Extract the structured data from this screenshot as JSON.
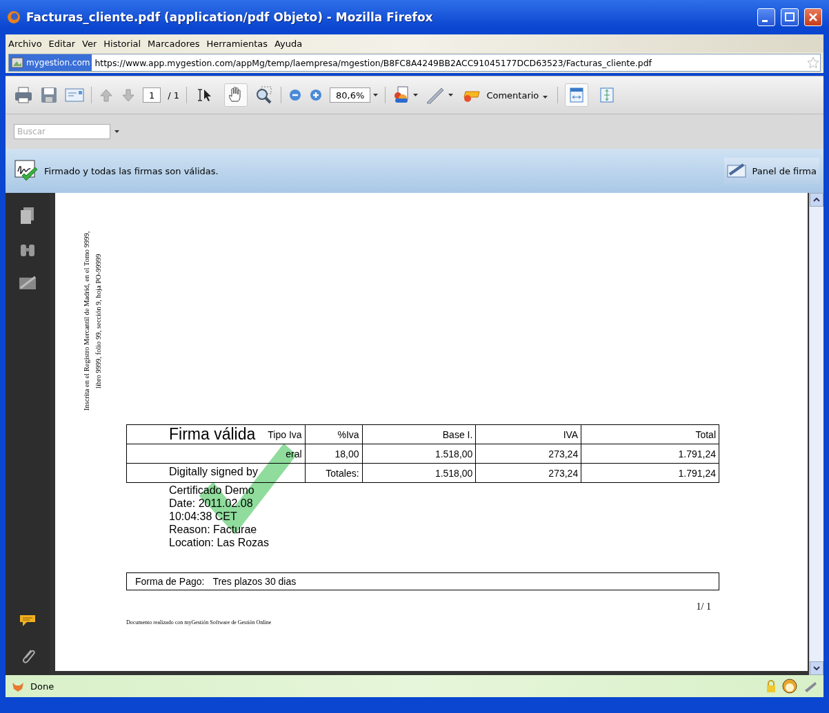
{
  "window": {
    "title": "Facturas_cliente.pdf (application/pdf Objeto) - Mozilla Firefox"
  },
  "menu": [
    {
      "label": "Archivo"
    },
    {
      "label": "Editar"
    },
    {
      "label": "Ver"
    },
    {
      "label": "Historial"
    },
    {
      "label": "Marcadores"
    },
    {
      "label": "Herramientas"
    },
    {
      "label": "Ayuda"
    }
  ],
  "address_bar": {
    "site": "mygestion.com",
    "url": "https://www.app.mygestion.com/appMg/temp/laempresa/mgestion/B8FC8A4249BB2ACC91045177DCD63523/Facturas_cliente.pdf"
  },
  "toolbar": {
    "page_field": "1",
    "page_total": "/ 1",
    "tools": [
      {
        "kind": "select",
        "selected": false
      },
      {
        "kind": "hand",
        "selected": true
      }
    ],
    "zoom_field": "80,6%",
    "comment_button": "Comentario",
    "views": [
      {
        "kind": "fit-width",
        "selected": true
      },
      {
        "kind": "fit-page",
        "selected": false
      }
    ]
  },
  "search": {
    "placeholder": "Buscar"
  },
  "signature_bar": {
    "message": "Firmado y todas las firmas son válidas.",
    "button": "Panel de firma"
  },
  "document": {
    "side_note": "Inscrita en el Registro Mercantil de Madrid, en el Tomo 9999, libro 9999, folio 99, sección 9, hoja PO-99999",
    "table": {
      "columns": [
        "Tipo Iva",
        "%Iva",
        "Base I.",
        "IVA",
        "Total"
      ],
      "rows": [
        [
          "eral",
          "18,00",
          "1.518,00",
          "273,24",
          "1.791,24"
        ],
        [
          "",
          "Totales:",
          "1.518,00",
          "273,24",
          "1.791,24"
        ]
      ]
    },
    "stamp": {
      "title": "Firma válida",
      "lines": [
        "Digitally signed by",
        "Certificado Demo",
        "Date: 2011.02.08",
        "10:04:38 CET",
        "Reason: Facturae",
        "Location: Las Rozas"
      ]
    },
    "payment": {
      "label": "Forma de Pago:",
      "value": "Tres plazos 30 dias"
    },
    "page_number": "1/ 1",
    "footer": "Documento realizado con myGestión Software de Gestión Online"
  },
  "status_bar": {
    "text": "Done"
  }
}
